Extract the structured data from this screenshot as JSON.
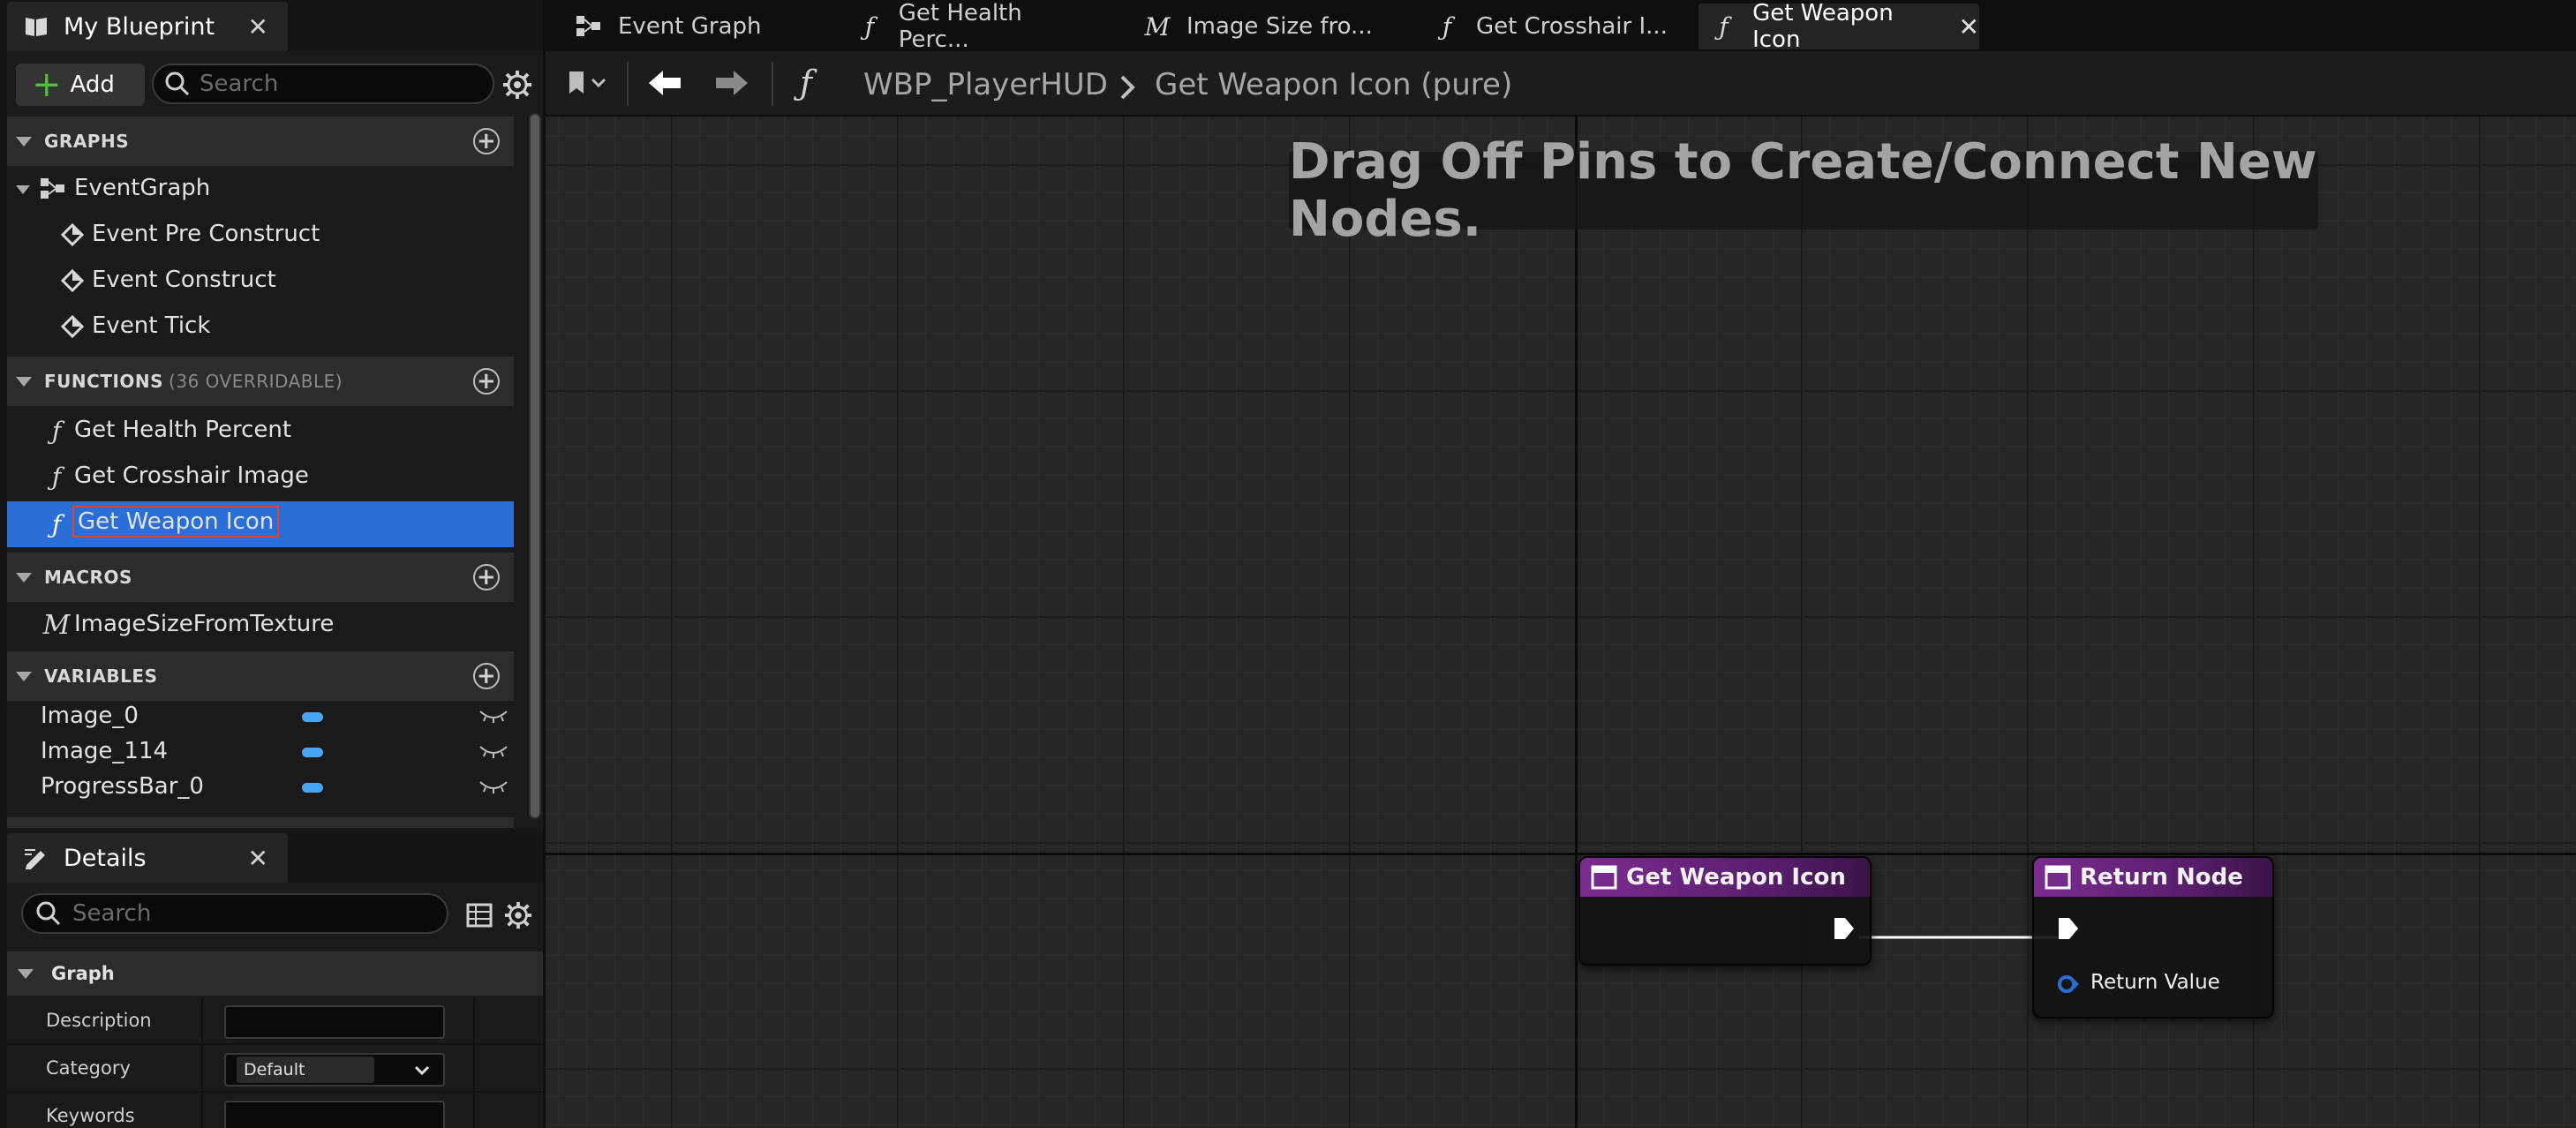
{
  "my_blueprint": {
    "tab_label": "My Blueprint",
    "add_label": "Add",
    "search_placeholder": "Search",
    "sections": {
      "graphs": "GRAPHS",
      "functions": "FUNCTIONS",
      "functions_sub": "(36 OVERRIDABLE)",
      "macros": "MACROS",
      "variables": "VARIABLES"
    },
    "graphs": {
      "event_graph": "EventGraph",
      "events": [
        "Event Pre Construct",
        "Event Construct",
        "Event Tick"
      ]
    },
    "functions": [
      "Get Health Percent",
      "Get Crosshair Image",
      "Get Weapon Icon"
    ],
    "macros": [
      "ImageSizeFromTexture"
    ],
    "variables": [
      "Image_0",
      "Image_114",
      "ProgressBar_0"
    ],
    "colors": {
      "selection": "#2a6ed8",
      "variable_pill": "#46a6f2",
      "add_plus": "#4fbf3a"
    }
  },
  "details": {
    "tab_label": "Details",
    "search_placeholder": "Search",
    "section": "Graph",
    "rows": {
      "description_label": "Description",
      "category_label": "Category",
      "category_value": "Default",
      "keywords_label": "Keywords"
    }
  },
  "doc_tabs": [
    {
      "label": "Event Graph",
      "icon": "event-graph-icon"
    },
    {
      "label": "Get Health Perc...",
      "icon": "function-icon"
    },
    {
      "label": "Image Size fro...",
      "icon": "macro-icon"
    },
    {
      "label": "Get Crosshair I...",
      "icon": "function-icon"
    },
    {
      "label": "Get Weapon Icon",
      "icon": "function-icon",
      "active": true
    }
  ],
  "breadcrumb": {
    "blueprint": "WBP_PlayerHUD",
    "function": "Get Weapon Icon (pure)"
  },
  "graph": {
    "hint": "Drag Off Pins to Create/Connect New Nodes.",
    "nodes": {
      "entry_title": "Get Weapon Icon",
      "return_title": "Return Node",
      "return_value_label": "Return Value"
    },
    "colors": {
      "node_header": "#7a2c8f",
      "return_pin": "#2a6ed8"
    }
  }
}
